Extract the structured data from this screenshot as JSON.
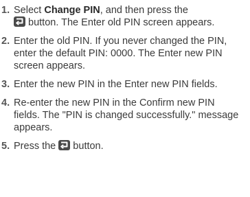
{
  "steps": [
    {
      "number": "1.",
      "pre": "Select ",
      "bold": "Change PIN",
      "mid": ", and then press the",
      "icon": "enter-button-icon",
      "post": " button. The Enter old PIN screen appears."
    },
    {
      "number": "2.",
      "text": "Enter the old PIN. If you never changed the PIN, enter the default PIN: 0000. The Enter new PIN screen appears."
    },
    {
      "number": "3.",
      "text": "Enter the new PIN in the Enter new PIN fields."
    },
    {
      "number": "4.",
      "text": "Re-enter the new PIN in the Confirm new PIN fields. The \"PIN is changed successfully.\" message appears."
    },
    {
      "number": "5.",
      "pre": "Press the ",
      "icon": "enter-button-icon",
      "post": " button."
    }
  ]
}
